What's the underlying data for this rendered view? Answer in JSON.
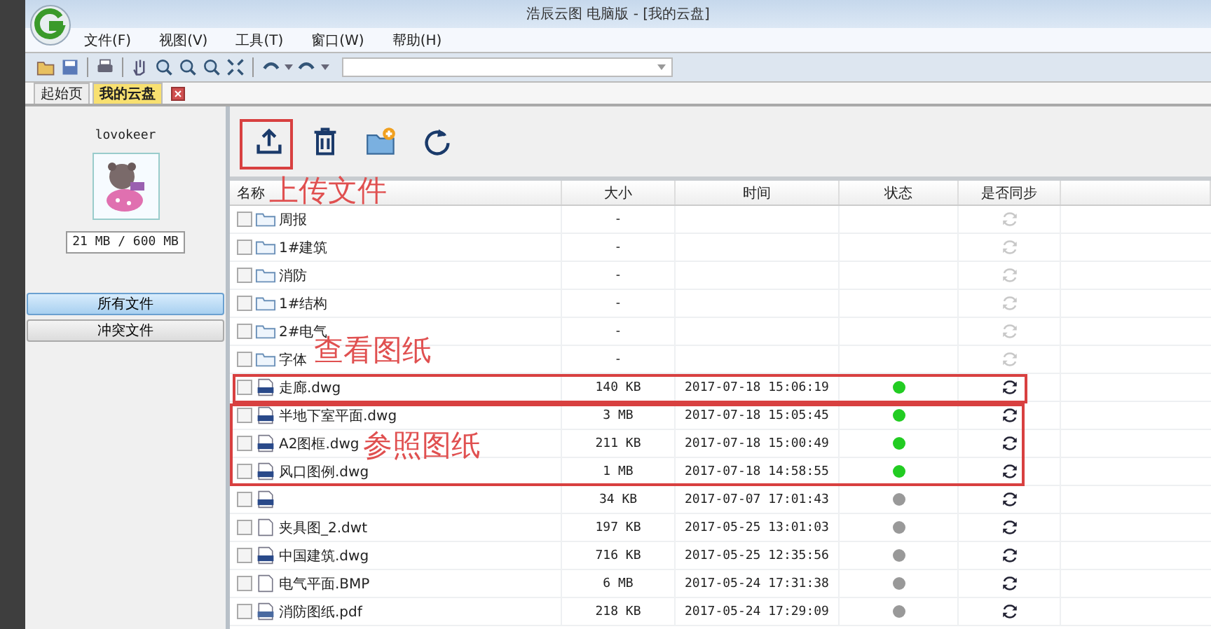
{
  "window": {
    "title": "浩辰云图 电脑版 - [我的云盘]"
  },
  "menu": [
    {
      "label": "文件(F)"
    },
    {
      "label": "视图(V)"
    },
    {
      "label": "工具(T)"
    },
    {
      "label": "窗口(W)"
    },
    {
      "label": "帮助(H)"
    }
  ],
  "doc_tabs": [
    {
      "label": "起始页",
      "selected": false
    },
    {
      "label": "我的云盘",
      "selected": true
    }
  ],
  "sidebar": {
    "username": "lovokeer",
    "storage": "21 MB / 600 MB",
    "items": [
      {
        "label": "所有文件",
        "selected": true
      },
      {
        "label": "冲突文件",
        "selected": false
      }
    ]
  },
  "table": {
    "columns": [
      "名称",
      "大小",
      "时间",
      "状态",
      "是否同步"
    ],
    "rows": [
      {
        "kind": "folder",
        "checked": false,
        "name": "周报",
        "size": "-"
      },
      {
        "kind": "folder",
        "checked": false,
        "name": "1#建筑",
        "size": "-"
      },
      {
        "kind": "folder",
        "checked": false,
        "name": "消防",
        "size": "-"
      },
      {
        "kind": "folder",
        "checked": false,
        "name": "1#结构",
        "size": "-"
      },
      {
        "kind": "folder",
        "checked": false,
        "name": "2#电气",
        "size": "-"
      },
      {
        "kind": "folder",
        "checked": false,
        "name": "字体",
        "size": "-"
      },
      {
        "kind": "dwg",
        "checked": false,
        "name": "走廊.dwg",
        "size": "140 KB",
        "time": "2017-07-18 15:06:19",
        "color": "#22cc22"
      },
      {
        "kind": "dwg",
        "checked": false,
        "name": "半地下室平面.dwg",
        "size": "3 MB",
        "time": "2017-07-18 15:05:45",
        "color": "#22cc22"
      },
      {
        "kind": "dwg",
        "checked": false,
        "name": "A2图框.dwg",
        "size": "211 KB",
        "time": "2017-07-18 15:00:49",
        "color": "#22cc22"
      },
      {
        "kind": "dwg",
        "checked": false,
        "name": "风口图例.dwg",
        "size": "1 MB",
        "time": "2017-07-18 14:58:55",
        "color": "#22cc22"
      },
      {
        "kind": "dwg",
        "checked": false,
        "size": "34 KB",
        "time": "2017-07-07 17:01:43",
        "color": "#999999"
      },
      {
        "kind": "doc",
        "checked": false,
        "name": "夹具图_2.dwt",
        "size": "197 KB",
        "time": "2017-05-25 13:01:03",
        "color": "#999999"
      },
      {
        "kind": "dwg",
        "checked": false,
        "name": "中国建筑.dwg",
        "size": "716 KB",
        "time": "2017-05-25 12:35:56",
        "color": "#999999"
      },
      {
        "kind": "doc",
        "checked": false,
        "name": "电气平面.BMP",
        "size": "6 MB",
        "time": "2017-05-24 17:31:38",
        "color": "#999999"
      },
      {
        "kind": "pdf",
        "checked": false,
        "name": "消防图纸.pdf",
        "size": "218 KB",
        "time": "2017-05-24 17:29:09",
        "color": "#999999"
      }
    ]
  },
  "annotations": [
    {
      "text": "上传文件"
    },
    {
      "text": "查看图纸"
    },
    {
      "text": "参照图纸"
    }
  ]
}
